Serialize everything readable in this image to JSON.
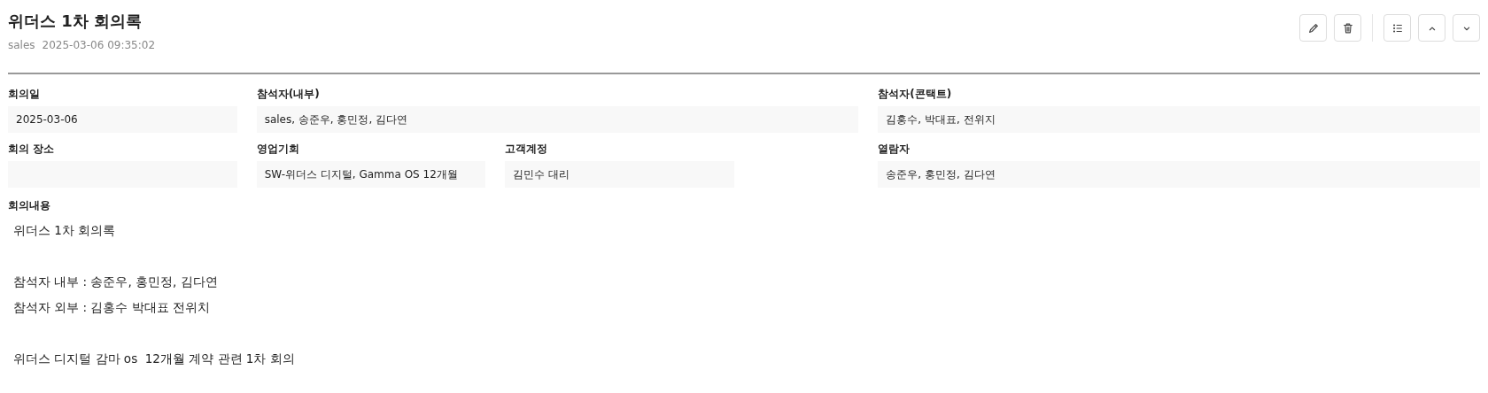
{
  "header": {
    "title": "위더스 1차 회의록",
    "author": "sales",
    "timestamp": "2025-03-06 09:35:02"
  },
  "toolbar": [
    {
      "kind": "edit"
    },
    {
      "kind": "delete"
    },
    {
      "kind": "list"
    },
    {
      "kind": "up"
    },
    {
      "kind": "down"
    }
  ],
  "field_rows": [
    [
      {
        "label": "회의일",
        "value": "2025-03-06"
      },
      {
        "label": "참석자(내부)",
        "value": "sales, 송준우, 홍민정, 김다연"
      },
      {
        "label": "참석자(콘택트)",
        "value": "김홍수, 박대표, 전위지"
      }
    ],
    [
      {
        "label": "회의 장소"
      },
      {
        "label": "영업기회",
        "value": "SW-위더스 디지털, Gamma OS 12개월"
      },
      {
        "label": "고객계정",
        "value": "김민수 대리"
      },
      {
        "label": "열람자",
        "value": "송준우, 홍민정, 김다연"
      }
    ]
  ],
  "content": {
    "label": "회의내용",
    "paragraphs": [
      [
        "위더스 1차 회의록"
      ],
      [
        "참석자 내부 : 송준우, 홍민정, 김다연",
        "참석자 외부 : 김홍수 박대표 전위치"
      ],
      [
        "위더스 디지털 감마 os  12개월 계약 관련 1차 회의"
      ]
    ]
  }
}
